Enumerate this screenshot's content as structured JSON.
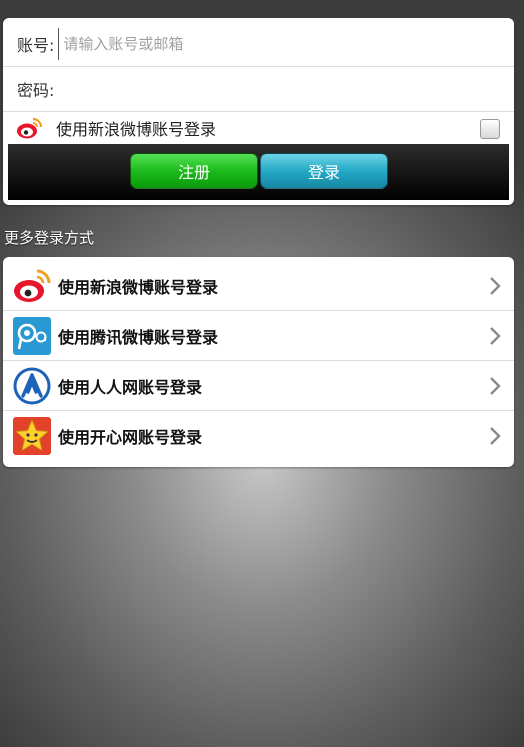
{
  "login": {
    "account_label": "账号:",
    "account_placeholder": "请输入账号或邮箱",
    "password_label": "密码:",
    "weibo_checkbox_label": "使用新浪微博账号登录",
    "register_button": "注册",
    "login_button": "登录"
  },
  "more_methods": {
    "title": "更多登录方式",
    "items": [
      {
        "label": "使用新浪微博账号登录",
        "icon": "sina-weibo-icon"
      },
      {
        "label": "使用腾讯微博账号登录",
        "icon": "tencent-weibo-icon"
      },
      {
        "label": "使用人人网账号登录",
        "icon": "renren-icon"
      },
      {
        "label": "使用开心网账号登录",
        "icon": "kaixin-icon"
      }
    ]
  },
  "colors": {
    "register_green": "#1cbb1c",
    "login_blue": "#23a9c6"
  }
}
